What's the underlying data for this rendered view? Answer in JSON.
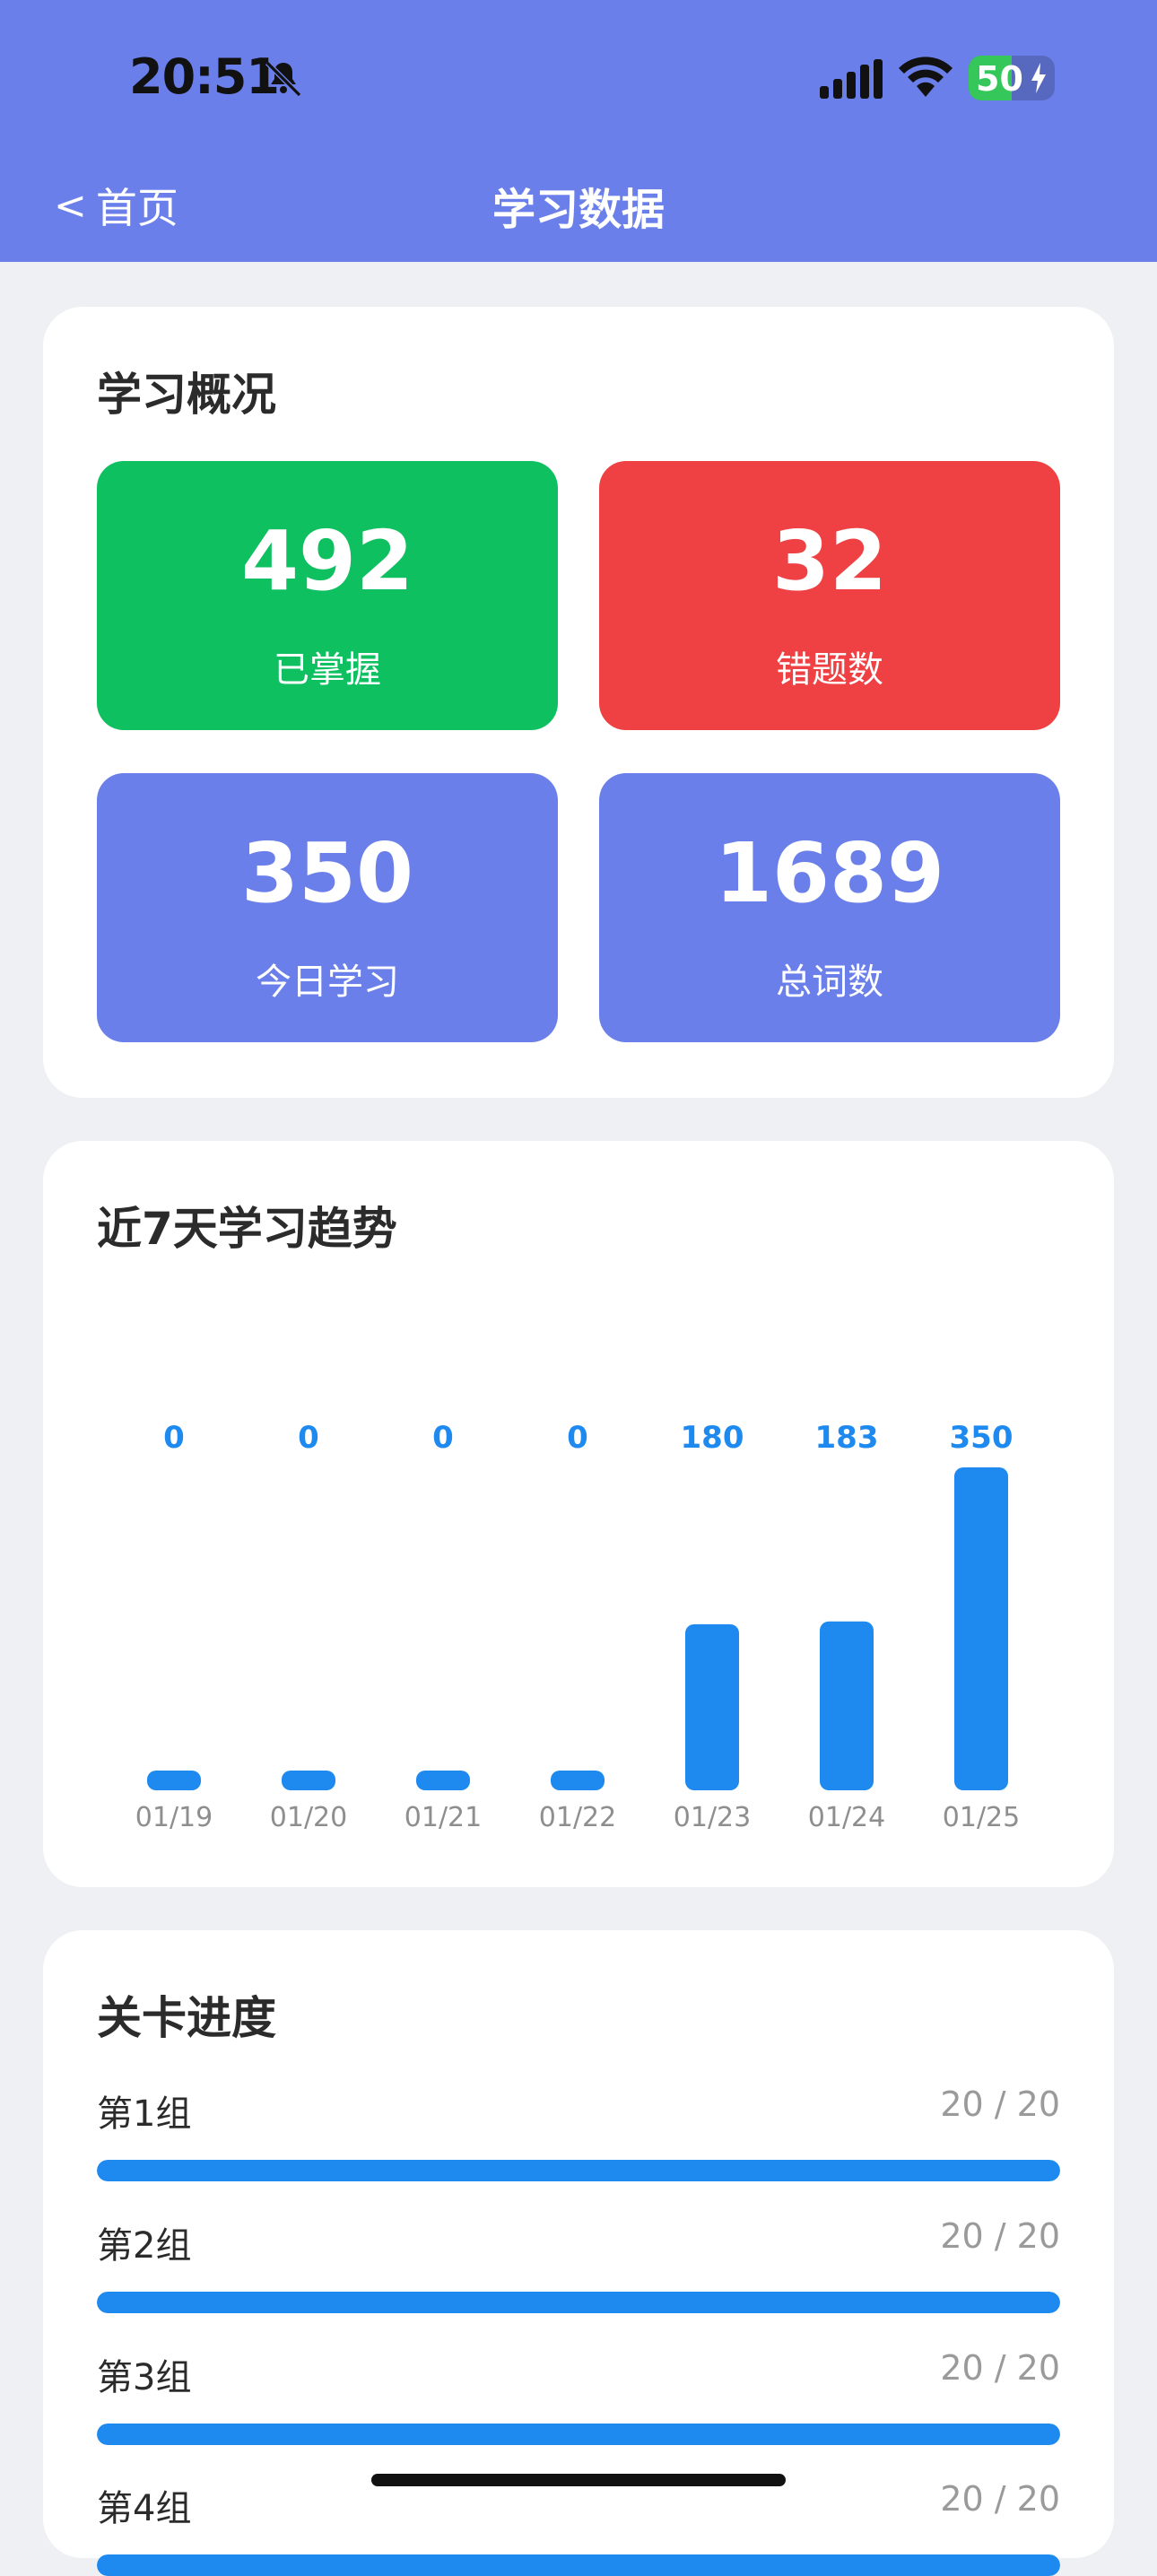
{
  "status_bar": {
    "time": "20:51",
    "battery": "50"
  },
  "nav": {
    "back_label": "首页",
    "title": "学习数据"
  },
  "overview": {
    "title": "学习概况",
    "tiles": [
      {
        "value": "492",
        "label": "已掌握",
        "color": "#0fc060"
      },
      {
        "value": "32",
        "label": "错题数",
        "color": "#ef4143"
      },
      {
        "value": "350",
        "label": "今日学习",
        "color": "#6a7fea"
      },
      {
        "value": "1689",
        "label": "总词数",
        "color": "#6a7fea"
      }
    ]
  },
  "trend": {
    "title": "近7天学习趋势"
  },
  "chart_data": {
    "type": "bar",
    "categories": [
      "01/19",
      "01/20",
      "01/21",
      "01/22",
      "01/23",
      "01/24",
      "01/25"
    ],
    "values": [
      0,
      0,
      0,
      0,
      180,
      183,
      350
    ],
    "ylim": [
      0,
      350
    ],
    "color": "#1e8af0",
    "grid": false
  },
  "progress": {
    "title": "关卡进度",
    "groups": [
      {
        "name": "第1组",
        "count": "20 / 20",
        "fraction": 1.0
      },
      {
        "name": "第2组",
        "count": "20 / 20",
        "fraction": 1.0
      },
      {
        "name": "第3组",
        "count": "20 / 20",
        "fraction": 1.0
      },
      {
        "name": "第4组",
        "count": "20 / 20",
        "fraction": 1.0
      }
    ]
  }
}
